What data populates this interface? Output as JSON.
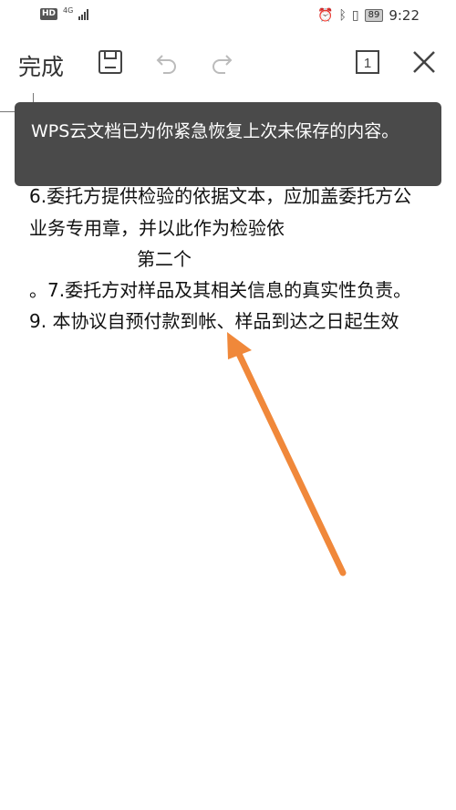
{
  "status_bar": {
    "hd_label": "HD",
    "network_label": "4G",
    "battery_level": "89",
    "time": "9:22",
    "icons": [
      "alarm-icon",
      "bluetooth-icon",
      "vibrate-icon",
      "battery-icon"
    ]
  },
  "toolbar": {
    "done_label": "完成",
    "page_number": "1",
    "icons": [
      "save-icon",
      "undo-icon",
      "redo-icon",
      "page-view-icon",
      "close-icon"
    ]
  },
  "toast": {
    "message": "WPS云文档已为你紧急恢复上次未保存的内容。"
  },
  "document": {
    "lines": [
      "6.委托方提供检验的依据文本，应加盖委托方公",
      "业务专用章，并以此作为检验依",
      "第二个",
      "。7.委托方对样品及其相关信息的真实性负责。",
      "9.  本协议自预付款到帐、样品到达之日起生效"
    ]
  },
  "annotation": {
    "arrow_color": "#f0883a"
  }
}
